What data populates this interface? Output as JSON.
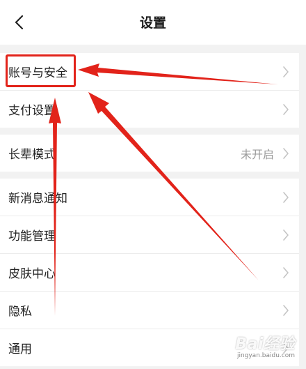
{
  "header": {
    "title": "设置",
    "back_icon": "chevron-left-icon"
  },
  "sections": [
    {
      "items": [
        {
          "label": "账号与安全",
          "value": ""
        },
        {
          "label": "支付设置",
          "value": ""
        }
      ]
    },
    {
      "items": [
        {
          "label": "长辈模式",
          "value": "未开启"
        }
      ]
    },
    {
      "items": [
        {
          "label": "新消息通知",
          "value": ""
        },
        {
          "label": "功能管理",
          "value": ""
        },
        {
          "label": "皮肤中心",
          "value": ""
        },
        {
          "label": "隐私",
          "value": ""
        },
        {
          "label": "通用",
          "value": ""
        }
      ]
    }
  ],
  "annotation": {
    "color": "#e2231a",
    "highlighted_item": "账号与安全"
  },
  "watermark": {
    "main": "Bai经验",
    "sub": "jingyan.baidu.com"
  }
}
